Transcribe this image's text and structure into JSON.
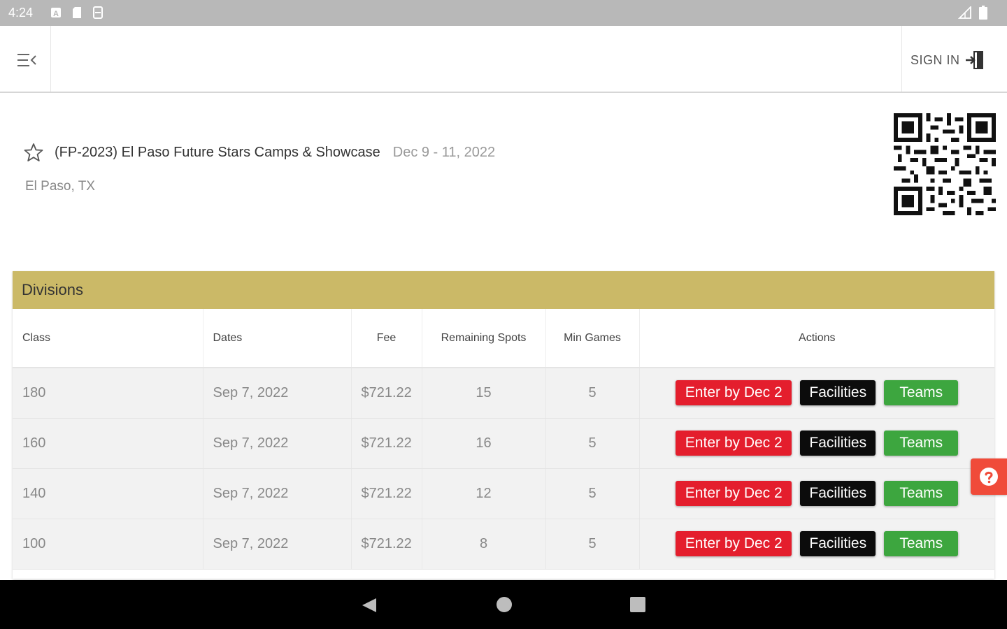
{
  "status_bar": {
    "time": "4:24",
    "icons": [
      "notification-a-icon",
      "sd-card-icon",
      "sync-icon"
    ],
    "right_icons": [
      "signal-icon",
      "battery-icon"
    ]
  },
  "app_bar": {
    "menu_icon": "menu-collapse-icon",
    "sign_in_label": "SIGN IN",
    "sign_in_icon": "login-icon"
  },
  "event": {
    "name": "(FP-2023) El Paso Future Stars Camps & Showcase",
    "dates": "Dec 9 - 11, 2022",
    "location": "El Paso, TX",
    "favorite_icon": "star-outline-icon"
  },
  "divisions": {
    "title": "Divisions",
    "columns": {
      "class": "Class",
      "dates": "Dates",
      "fee": "Fee",
      "remaining": "Remaining Spots",
      "min_games": "Min Games",
      "actions": "Actions"
    },
    "rows": [
      {
        "class": "180",
        "date": "Sep 7, 2022",
        "fee": "$721.22",
        "remaining": "15",
        "min_games": "5",
        "enter": "Enter by Dec 2",
        "facilities": "Facilities",
        "teams": "Teams"
      },
      {
        "class": "160",
        "date": "Sep 7, 2022",
        "fee": "$721.22",
        "remaining": "16",
        "min_games": "5",
        "enter": "Enter by Dec 2",
        "facilities": "Facilities",
        "teams": "Teams"
      },
      {
        "class": "140",
        "date": "Sep 7, 2022",
        "fee": "$721.22",
        "remaining": "12",
        "min_games": "5",
        "enter": "Enter by Dec 2",
        "facilities": "Facilities",
        "teams": "Teams"
      },
      {
        "class": "100",
        "date": "Sep 7, 2022",
        "fee": "$721.22",
        "remaining": "8",
        "min_games": "5",
        "enter": "Enter by Dec 2",
        "facilities": "Facilities",
        "teams": "Teams"
      }
    ]
  },
  "colors": {
    "divisions_header": "#cbb967",
    "enter_button": "#e41e2d",
    "facilities_button": "#0c0c0c",
    "teams_button": "#3da63f",
    "help_button": "#f04b3a"
  },
  "help_icon": "help-circle-icon",
  "nav_bar": {
    "back_icon": "back-triangle-icon",
    "home_icon": "home-circle-icon",
    "recent_icon": "recents-square-icon"
  }
}
